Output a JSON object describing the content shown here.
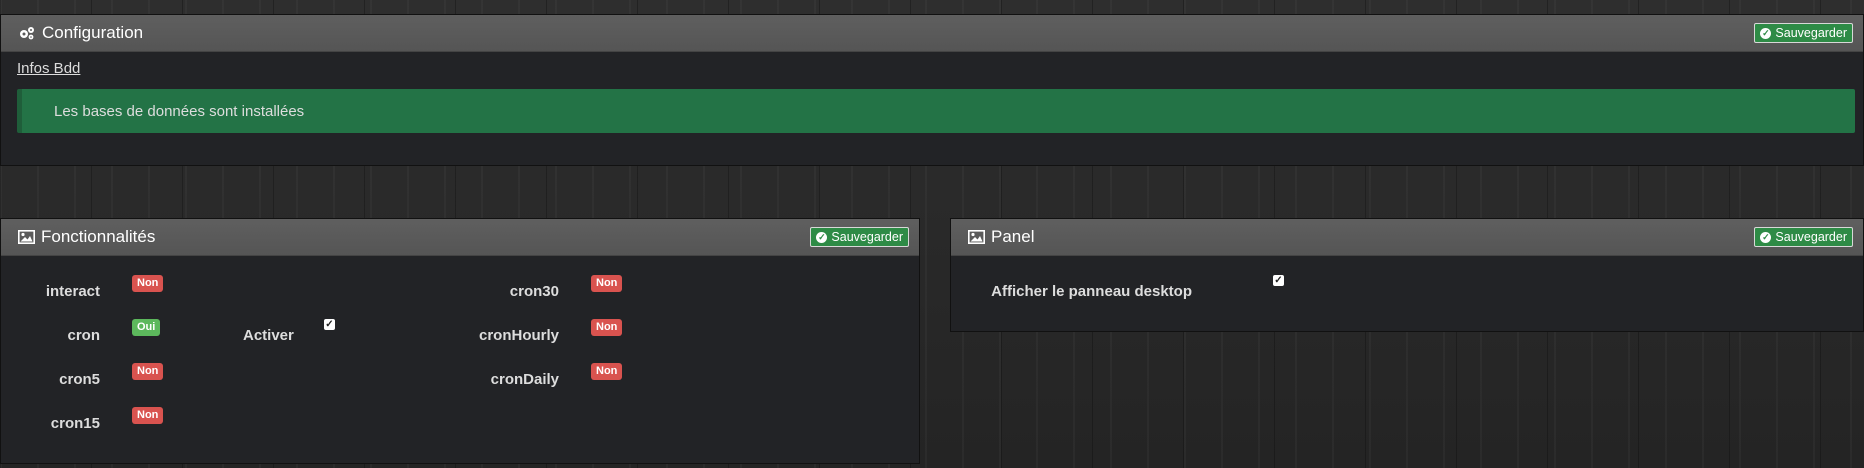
{
  "config_panel": {
    "title": "Configuration",
    "save_label": "Sauvegarder",
    "link_label": "Infos Bdd",
    "alert_text": "Les bases de données sont installées"
  },
  "features_panel": {
    "title": "Fonctionnalités",
    "save_label": "Sauvegarder",
    "items": [
      {
        "label": "interact",
        "status": "Non"
      },
      {
        "label": "cron",
        "status": "Oui"
      },
      {
        "label": "cron5",
        "status": "Non"
      },
      {
        "label": "cron15",
        "status": "Non"
      },
      {
        "label": "cron30",
        "status": "Non"
      },
      {
        "label": "cronHourly",
        "status": "Non"
      },
      {
        "label": "cronDaily",
        "status": "Non"
      }
    ],
    "activate_label": "Activer",
    "activate_checked": true
  },
  "panel_panel": {
    "title": "Panel",
    "save_label": "Sauvegarder",
    "desktop_label": "Afficher le panneau desktop",
    "desktop_checked": true
  },
  "colors": {
    "success": "#5cb85c",
    "danger": "#d9534f",
    "alert_green": "#237346",
    "save_green": "#2e8b46"
  },
  "icons": {
    "configuration": "gears-icon",
    "features": "picture-icon",
    "panel": "picture-icon",
    "save": "check-circle-icon",
    "checkbox": "checkbox-checked-icon"
  }
}
